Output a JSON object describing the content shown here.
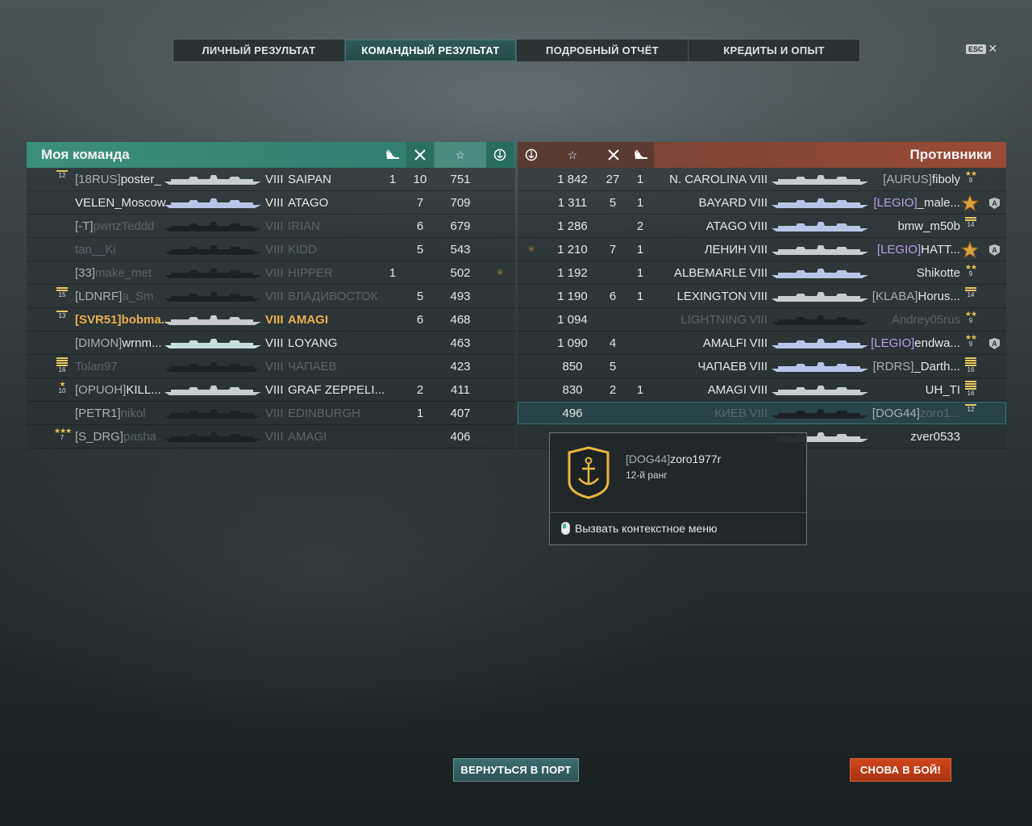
{
  "tabs": [
    {
      "label": "ЛИЧНЫЙ РЕЗУЛЬТАТ"
    },
    {
      "label": "КОМАНДНЫЙ РЕЗУЛЬТАТ"
    },
    {
      "label": "ПОДРОБНЫЙ ОТЧЁТ"
    },
    {
      "label": "КРЕДИТЫ И ОПЫТ"
    }
  ],
  "esc_label": "ESC",
  "my_team": {
    "title": "Моя команда",
    "rows": [
      {
        "tag": "[18RUS]",
        "name": "poster_",
        "tier": "VIII",
        "ship": "SAIPAN",
        "c1": "1",
        "c2": "10",
        "score": "751",
        "rank": "12"
      },
      {
        "tag": "",
        "name": "VELEN_Moscow",
        "tier": "VIII",
        "ship": "ATAGO",
        "c1": "",
        "c2": "7",
        "score": "709",
        "rank": ""
      },
      {
        "tag": "[-T]",
        "name": "pwnzTeddd",
        "tier": "VIII",
        "ship": "IRIAN",
        "c1": "",
        "c2": "6",
        "score": "679",
        "rank": ""
      },
      {
        "tag": "",
        "name": "tan__Ki",
        "tier": "VIII",
        "ship": "KIDD",
        "c1": "",
        "c2": "5",
        "score": "543",
        "rank": ""
      },
      {
        "tag": "[33]",
        "name": "make_met",
        "tier": "VIII",
        "ship": "HIPPER",
        "c1": "1",
        "c2": "",
        "score": "502",
        "rank": ""
      },
      {
        "tag": "[LDNRF]",
        "name": "a_Sm",
        "tier": "VIII",
        "ship": "ВЛАДИВОСТОК",
        "c1": "",
        "c2": "5",
        "score": "493",
        "rank": "15"
      },
      {
        "tag": "[SVR51]",
        "name": "bobma...",
        "tier": "VIII",
        "ship": "AMAGI",
        "c1": "",
        "c2": "6",
        "score": "468",
        "rank": "13"
      },
      {
        "tag": "[DIMON]",
        "name": "wrnm...",
        "tier": "VIII",
        "ship": "LOYANG",
        "c1": "",
        "c2": "",
        "score": "463",
        "rank": ""
      },
      {
        "tag": "",
        "name": "Tolan97",
        "tier": "VIII",
        "ship": "ЧАПАЕВ",
        "c1": "",
        "c2": "",
        "score": "423",
        "rank": "16"
      },
      {
        "tag": "[OPUOH]",
        "name": "KILL...",
        "tier": "VIII",
        "ship": "GRAF ZEPPELI...",
        "c1": "",
        "c2": "2",
        "score": "411",
        "rank": "10"
      },
      {
        "tag": "[PETR1]",
        "name": "nikol",
        "tier": "VIII",
        "ship": "EDINBURGH",
        "c1": "",
        "c2": "1",
        "score": "407",
        "rank": ""
      },
      {
        "tag": "[S_DRG]",
        "name": "pasha",
        "tier": "VIII",
        "ship": "AMAGI",
        "c1": "",
        "c2": "",
        "score": "406",
        "rank": "7"
      }
    ]
  },
  "enemy_team": {
    "title": "Противники",
    "rows": [
      {
        "score": "1 842",
        "c2": "27",
        "c1": "1",
        "ship": "N. CAROLINA",
        "tier": "VIII",
        "tag": "[AURUS]",
        "name": "fiboly",
        "rank": "9"
      },
      {
        "score": "1 311",
        "c2": "5",
        "c1": "1",
        "ship": "BAYARD",
        "tier": "VIII",
        "tag": "[LEGIO]",
        "name": "_male...",
        "rank": ""
      },
      {
        "score": "1 286",
        "c2": "",
        "c1": "2",
        "ship": "ATAGO",
        "tier": "VIII",
        "tag": "",
        "name": "bmw_m50b",
        "rank": "14"
      },
      {
        "score": "1 210",
        "c2": "7",
        "c1": "1",
        "ship": "ЛЕНИН",
        "tier": "VIII",
        "tag": "[LEGIO]",
        "name": "HATT...",
        "rank": ""
      },
      {
        "score": "1 192",
        "c2": "",
        "c1": "1",
        "ship": "ALBEMARLE",
        "tier": "VIII",
        "tag": "",
        "name": "Shikotte",
        "rank": "9"
      },
      {
        "score": "1 190",
        "c2": "6",
        "c1": "1",
        "ship": "LEXINGTON",
        "tier": "VIII",
        "tag": "[KLABA]",
        "name": "Horus...",
        "rank": "14"
      },
      {
        "score": "1 094",
        "c2": "",
        "c1": "",
        "ship": "LIGHTNING",
        "tier": "VIII",
        "tag": "",
        "name": "Andrey05rus",
        "rank": "9"
      },
      {
        "score": "1 090",
        "c2": "4",
        "c1": "",
        "ship": "AMALFI",
        "tier": "VIII",
        "tag": "[LEGIO]",
        "name": "endwa...",
        "rank": "9"
      },
      {
        "score": "850",
        "c2": "5",
        "c1": "",
        "ship": "ЧАПАЕВ",
        "tier": "VIII",
        "tag": "[RDRS]",
        "name": "_Darth...",
        "rank": "16"
      },
      {
        "score": "830",
        "c2": "2",
        "c1": "1",
        "ship": "AMAGI",
        "tier": "VIII",
        "tag": "",
        "name": "UH_TI",
        "rank": "16"
      },
      {
        "score": "496",
        "c2": "",
        "c1": "",
        "ship": "КИЕВ",
        "tier": "VIII",
        "tag": "[DOG44]",
        "name": "zoro1...",
        "rank": "12"
      },
      {
        "score": "",
        "c2": "",
        "c1": "",
        "ship": "",
        "tier": "",
        "tag": "",
        "name": "zver0533",
        "rank": ""
      }
    ]
  },
  "tooltip": {
    "tag": "[DOG44]",
    "name": "zoro1977r",
    "rank_text": "12-й ранг",
    "context_menu": "Вызвать контекстное меню"
  },
  "buttons": {
    "port": "ВЕРНУТЬСЯ В ПОРТ",
    "battle": "СНОВА В БОЙ!"
  },
  "colors": {
    "my_team_header": "#3b8f7c",
    "enemy_header": "#9a4a35",
    "clan_purple": "#b9a0e6",
    "player_gold": "#e8b04a",
    "battle_button": "#d0471a"
  }
}
